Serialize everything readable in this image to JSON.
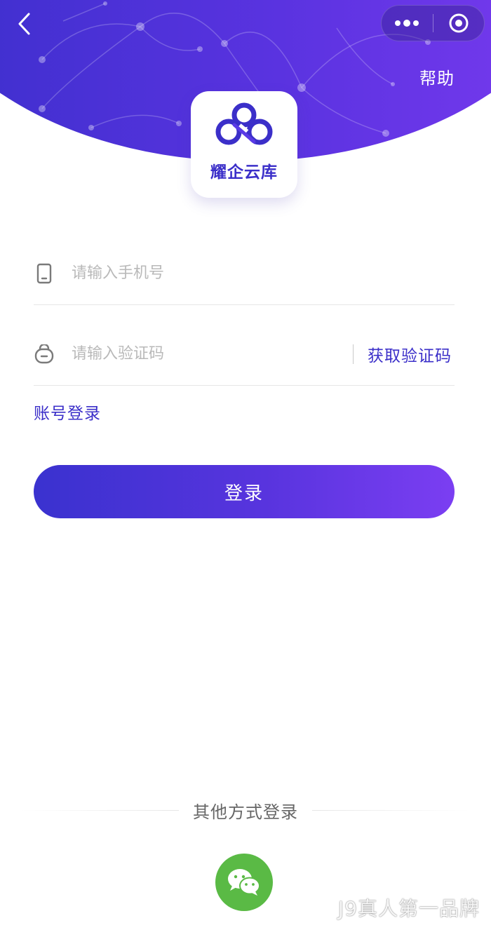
{
  "header": {
    "help_label": "帮助",
    "back_icon": "chevron-left-icon",
    "menu_icon": "more-dots-icon",
    "close_icon": "target-circle-icon"
  },
  "logo": {
    "name": "耀企云库",
    "icon": "cloud-infinity-logo"
  },
  "form": {
    "phone_placeholder": "请输入手机号",
    "phone_icon": "phone-icon",
    "code_placeholder": "请输入验证码",
    "code_icon": "lock-icon",
    "get_code_label": "获取验证码",
    "account_login_label": "账号登录",
    "login_button_label": "登录"
  },
  "other_login": {
    "label": "其他方式登录",
    "wechat_icon": "wechat-icon"
  },
  "watermark": "J9真人第一品牌",
  "colors": {
    "brand": "#3b2fc9",
    "gradient_start": "#3a2fcb",
    "gradient_end": "#7a3af0",
    "wechat_green": "#5aba45"
  }
}
